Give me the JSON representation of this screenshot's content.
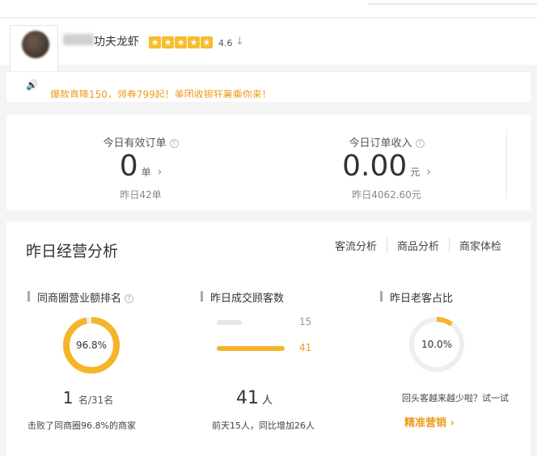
{
  "store": {
    "name": "功夫龙虾",
    "rating": "4.6",
    "stars": [
      "★",
      "★",
      "★",
      "★",
      "★"
    ],
    "rating_trend_icon": "down-arrow-icon"
  },
  "notice": {
    "icon": "speaker-icon",
    "text": "爆款直降150，领券799起！美团收银狂暑乘你来！"
  },
  "today": {
    "orders": {
      "label": "今日有效订单",
      "value": "0",
      "unit": "单",
      "sub": "昨日42单"
    },
    "revenue": {
      "label": "今日订单收入",
      "value": "0.00",
      "unit": "元",
      "sub": "昨日4062.60元"
    }
  },
  "analysis": {
    "title": "昨日经营分析",
    "links": [
      "客流分析",
      "商品分析",
      "商家体检"
    ],
    "ranking": {
      "title": "同商圈营业额排名",
      "percent_label": "96.8%",
      "percent": 0.968,
      "rank": "1",
      "rank_unit": "名/31名",
      "footnote": "击败了同商圈96.8%的商家"
    },
    "customers": {
      "title": "昨日成交顾客数",
      "bars": [
        {
          "value": 15,
          "label": "15",
          "color": "#e6e6e6",
          "text_color": "#999999"
        },
        {
          "value": 41,
          "label": "41",
          "color": "#f5b52a",
          "text_color": "#f09a1a"
        }
      ],
      "count": "41",
      "count_unit": "人",
      "footnote": "前天15人，同比增加26人"
    },
    "returning": {
      "title": "昨日老客占比",
      "percent_label": "10.0%",
      "percent": 0.1,
      "hint": "回头客越来越少啦？试一试",
      "cta": "精准营销 ›"
    }
  },
  "colors": {
    "accent": "#f5b52a",
    "accent_text": "#f09a1a",
    "ring_track": "#eeeeee"
  }
}
